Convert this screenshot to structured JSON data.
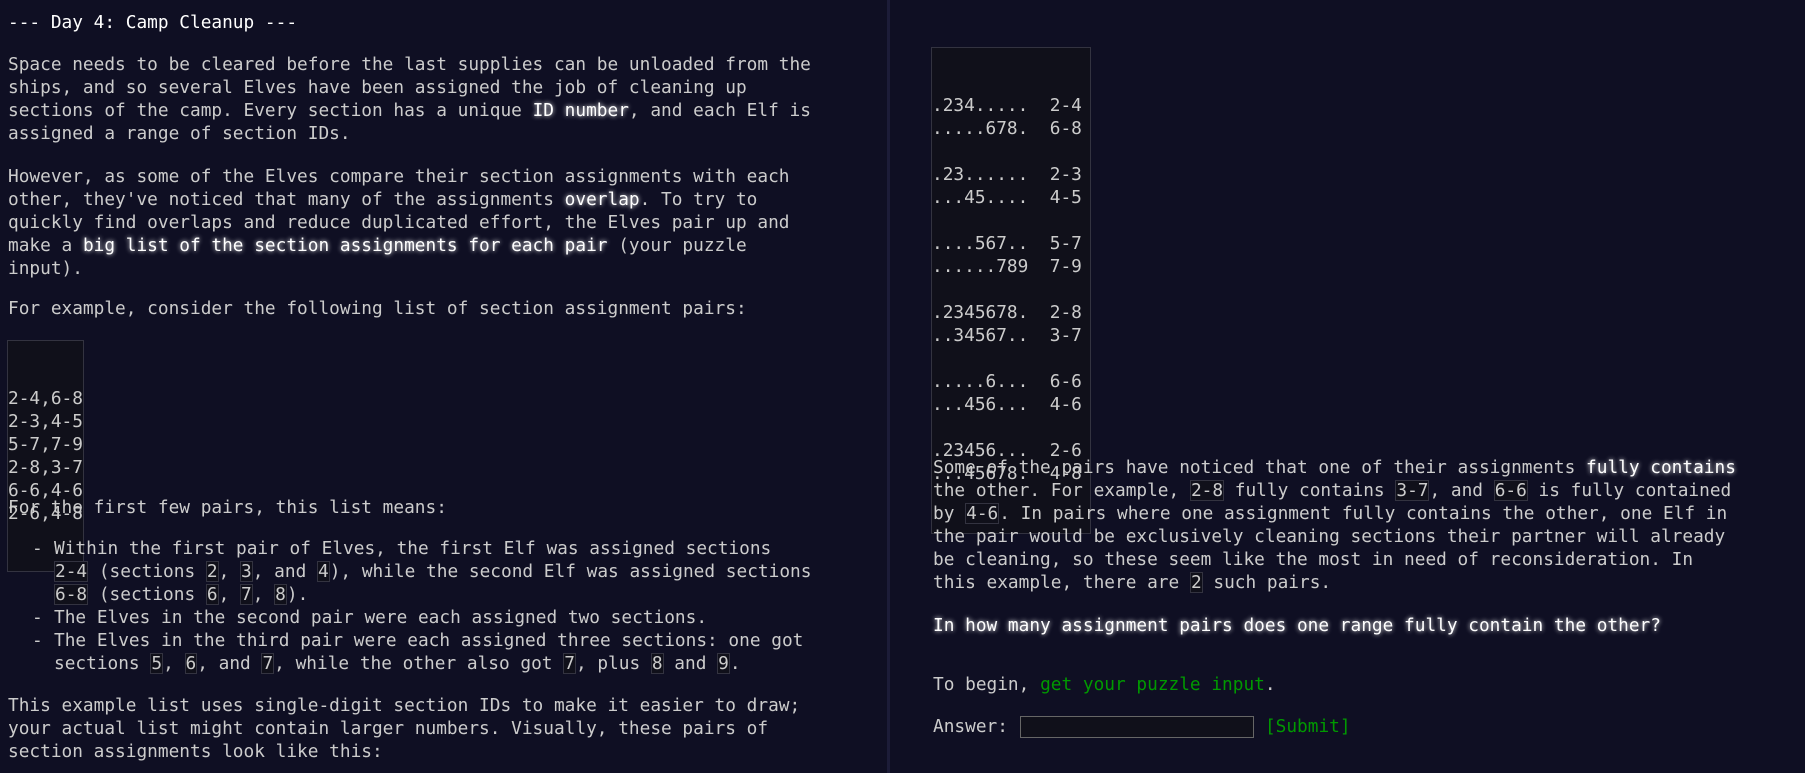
{
  "title": "--- Day 4: Camp Cleanup ---",
  "left": {
    "p1": {
      "l1": "Space needs to be cleared before the last supplies can be unloaded from the",
      "l2": "ships, and so several Elves have been assigned the job of cleaning up",
      "l3a": "sections of the camp. Every section has a unique ",
      "l3em": "ID number",
      "l3b": ", and each Elf is",
      "l4": "assigned a range of section IDs."
    },
    "p2": {
      "l1": "However, as some of the Elves compare their section assignments with each",
      "l2a": "other, they've noticed that many of the assignments ",
      "l2em": "overlap",
      "l2b": ". To try to",
      "l3": "quickly find overlaps and reduce duplicated effort, the Elves pair up and",
      "l4a": "make a ",
      "l4em": "big list of the section assignments for each pair",
      "l4b": " (your puzzle",
      "l5": "input)."
    },
    "p3": "For example, consider the following list of section assignment pairs:",
    "example_pairs": [
      "2-4,6-8",
      "2-3,4-5",
      "5-7,7-9",
      "2-8,3-7",
      "6-6,4-6",
      "2-6,4-8"
    ],
    "p4": "For the first few pairs, this list means:",
    "bullets": {
      "dash": "-",
      "b1_l1": "Within the first pair of Elves, the first Elf was assigned sections",
      "b1_l2_code": "2-4",
      "b1_l2a": " (sections ",
      "b1_l2_c2": "2",
      "b1_l2b": ", ",
      "b1_l2_c3": "3",
      "b1_l2c": ", and ",
      "b1_l2_c4": "4",
      "b1_l2d": "), while the second Elf was assigned sections",
      "b1_l3_code": "6-8",
      "b1_l3a": " (sections ",
      "b1_l3_c6": "6",
      "b1_l3b": ", ",
      "b1_l3_c7": "7",
      "b1_l3c": ", ",
      "b1_l3_c8": "8",
      "b1_l3d": ").",
      "b2": "The Elves in the second pair were each assigned two sections.",
      "b3_l1": "The Elves in the third pair were each assigned three sections: one got",
      "b3_l2a": "sections ",
      "b3_l2_c5": "5",
      "b3_l2b": ", ",
      "b3_l2_c6": "6",
      "b3_l2c": ", and ",
      "b3_l2_c7": "7",
      "b3_l2d": ", while the other also got ",
      "b3_l2_c7b": "7",
      "b3_l2e": ", plus ",
      "b3_l2_c8": "8",
      "b3_l2f": " and ",
      "b3_l2_c9": "9",
      "b3_l2g": "."
    },
    "p5": {
      "l1": "This example list uses single-digit section IDs to make it easier to draw;",
      "l2": "your actual list might contain larger numbers. Visually, these pairs of",
      "l3": "section assignments look like this:"
    }
  },
  "right": {
    "diagram_lines": [
      ".234.....  2-4",
      ".....678.  6-8",
      "",
      ".23......  2-3",
      "...45....  4-5",
      "",
      "....567..  5-7",
      "......789  7-9",
      "",
      ".2345678.  2-8",
      "..34567..  3-7",
      "",
      ".....6...  6-6",
      "...456...  4-6",
      "",
      ".23456...  2-6",
      "...45678.  4-8"
    ],
    "p1": {
      "l1a": "Some of the pairs have noticed that one of their assignments ",
      "l1em": "fully contains",
      "l2a": "the other. For example, ",
      "l2_c1": "2-8",
      "l2b": " fully contains ",
      "l2_c2": "3-7",
      "l2c": ", and ",
      "l2_c3": "6-6",
      "l2d": " is fully contained",
      "l3a": "by ",
      "l3_c1": "4-6",
      "l3b": ". In pairs where one assignment fully contains the other, one Elf in",
      "l4": "the pair would be exclusively cleaning sections their partner will already",
      "l5": "be cleaning, so these seem like the most in need of reconsideration. In",
      "l6a": "this example, there are ",
      "l6_c": "2",
      "l6b": " such pairs."
    },
    "question": "In how many assignment pairs does one range fully contain the other?",
    "begin_text": "To begin, ",
    "input_link": "get your puzzle input",
    "begin_end": ".",
    "answer_label": "Answer:",
    "answer_value": "",
    "submit_label": "[Submit]"
  }
}
